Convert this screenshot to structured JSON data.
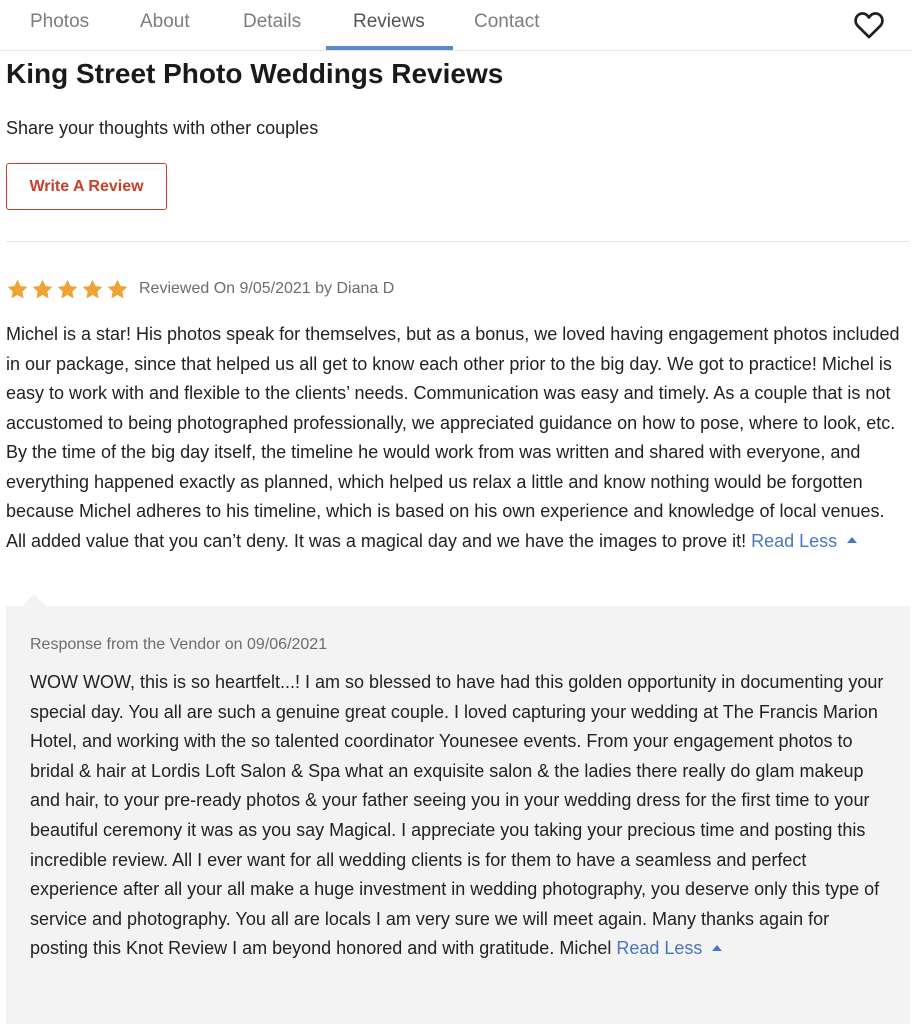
{
  "tabs": [
    {
      "label": "Photos",
      "active": false
    },
    {
      "label": "About",
      "active": false
    },
    {
      "label": "Details",
      "active": false
    },
    {
      "label": "Reviews",
      "active": true
    },
    {
      "label": "Contact",
      "active": false
    }
  ],
  "favorite_icon": "heart-outline-icon",
  "page": {
    "title": "King Street Photo Weddings Reviews",
    "subtitle": "Share your thoughts with other couples",
    "write_review_label": "Write A Review"
  },
  "colors": {
    "accent_blue": "#5b87c9",
    "link_blue": "#4a76be",
    "button_red": "#c8402a",
    "star_orange": "#f0a235",
    "response_bg": "#f3f3f3"
  },
  "review": {
    "rating": 5,
    "rating_max": 5,
    "meta": "Reviewed On 9/05/2021 by Diana D",
    "text": "Michel is a star! His photos speak for themselves, but as a bonus, we loved having engagement photos included in our package, since that helped us all get to know each other prior to the big day. We got to practice! Michel is easy to work with and flexible to the clients’ needs. Communication was easy and timely. As a couple that is not accustomed to being photographed professionally, we appreciated guidance on how to pose, where to look, etc. By the time of the big day itself, the timeline he would work from was written and shared with everyone, and everything happened exactly as planned, which helped us relax a little and know nothing would be forgotten because Michel adheres to his timeline, which is based on his own experience and knowledge of local venues. All added value that you can’t deny. It was a magical day and we have the images to prove it!",
    "read_less": "Read Less"
  },
  "response": {
    "header": "Response from the Vendor on 09/06/2021",
    "text": "WOW WOW, this is so heartfelt...! I am so blessed to have had this golden opportunity in documenting your special day. You all are such a genuine great couple. I loved capturing your wedding at The Francis Marion Hotel, and working with the so talented coordinator Younesee events. From your engagement photos to bridal & hair at Lordis Loft Salon & Spa what an exquisite salon & the ladies there really do glam makeup and hair, to your pre-ready photos & your father seeing you in your wedding dress for the first time to your beautiful ceremony it was as you say Magical. I appreciate you taking your precious time and posting this incredible review. All I ever want for all wedding clients is for them to have a seamless and perfect experience after all your all make a huge investment in wedding photography, you deserve only this type of service and photography. You all are locals I am very sure we will meet again. Many thanks again for posting this Knot Review I am beyond honored and with gratitude. Michel",
    "read_less": "Read Less"
  }
}
